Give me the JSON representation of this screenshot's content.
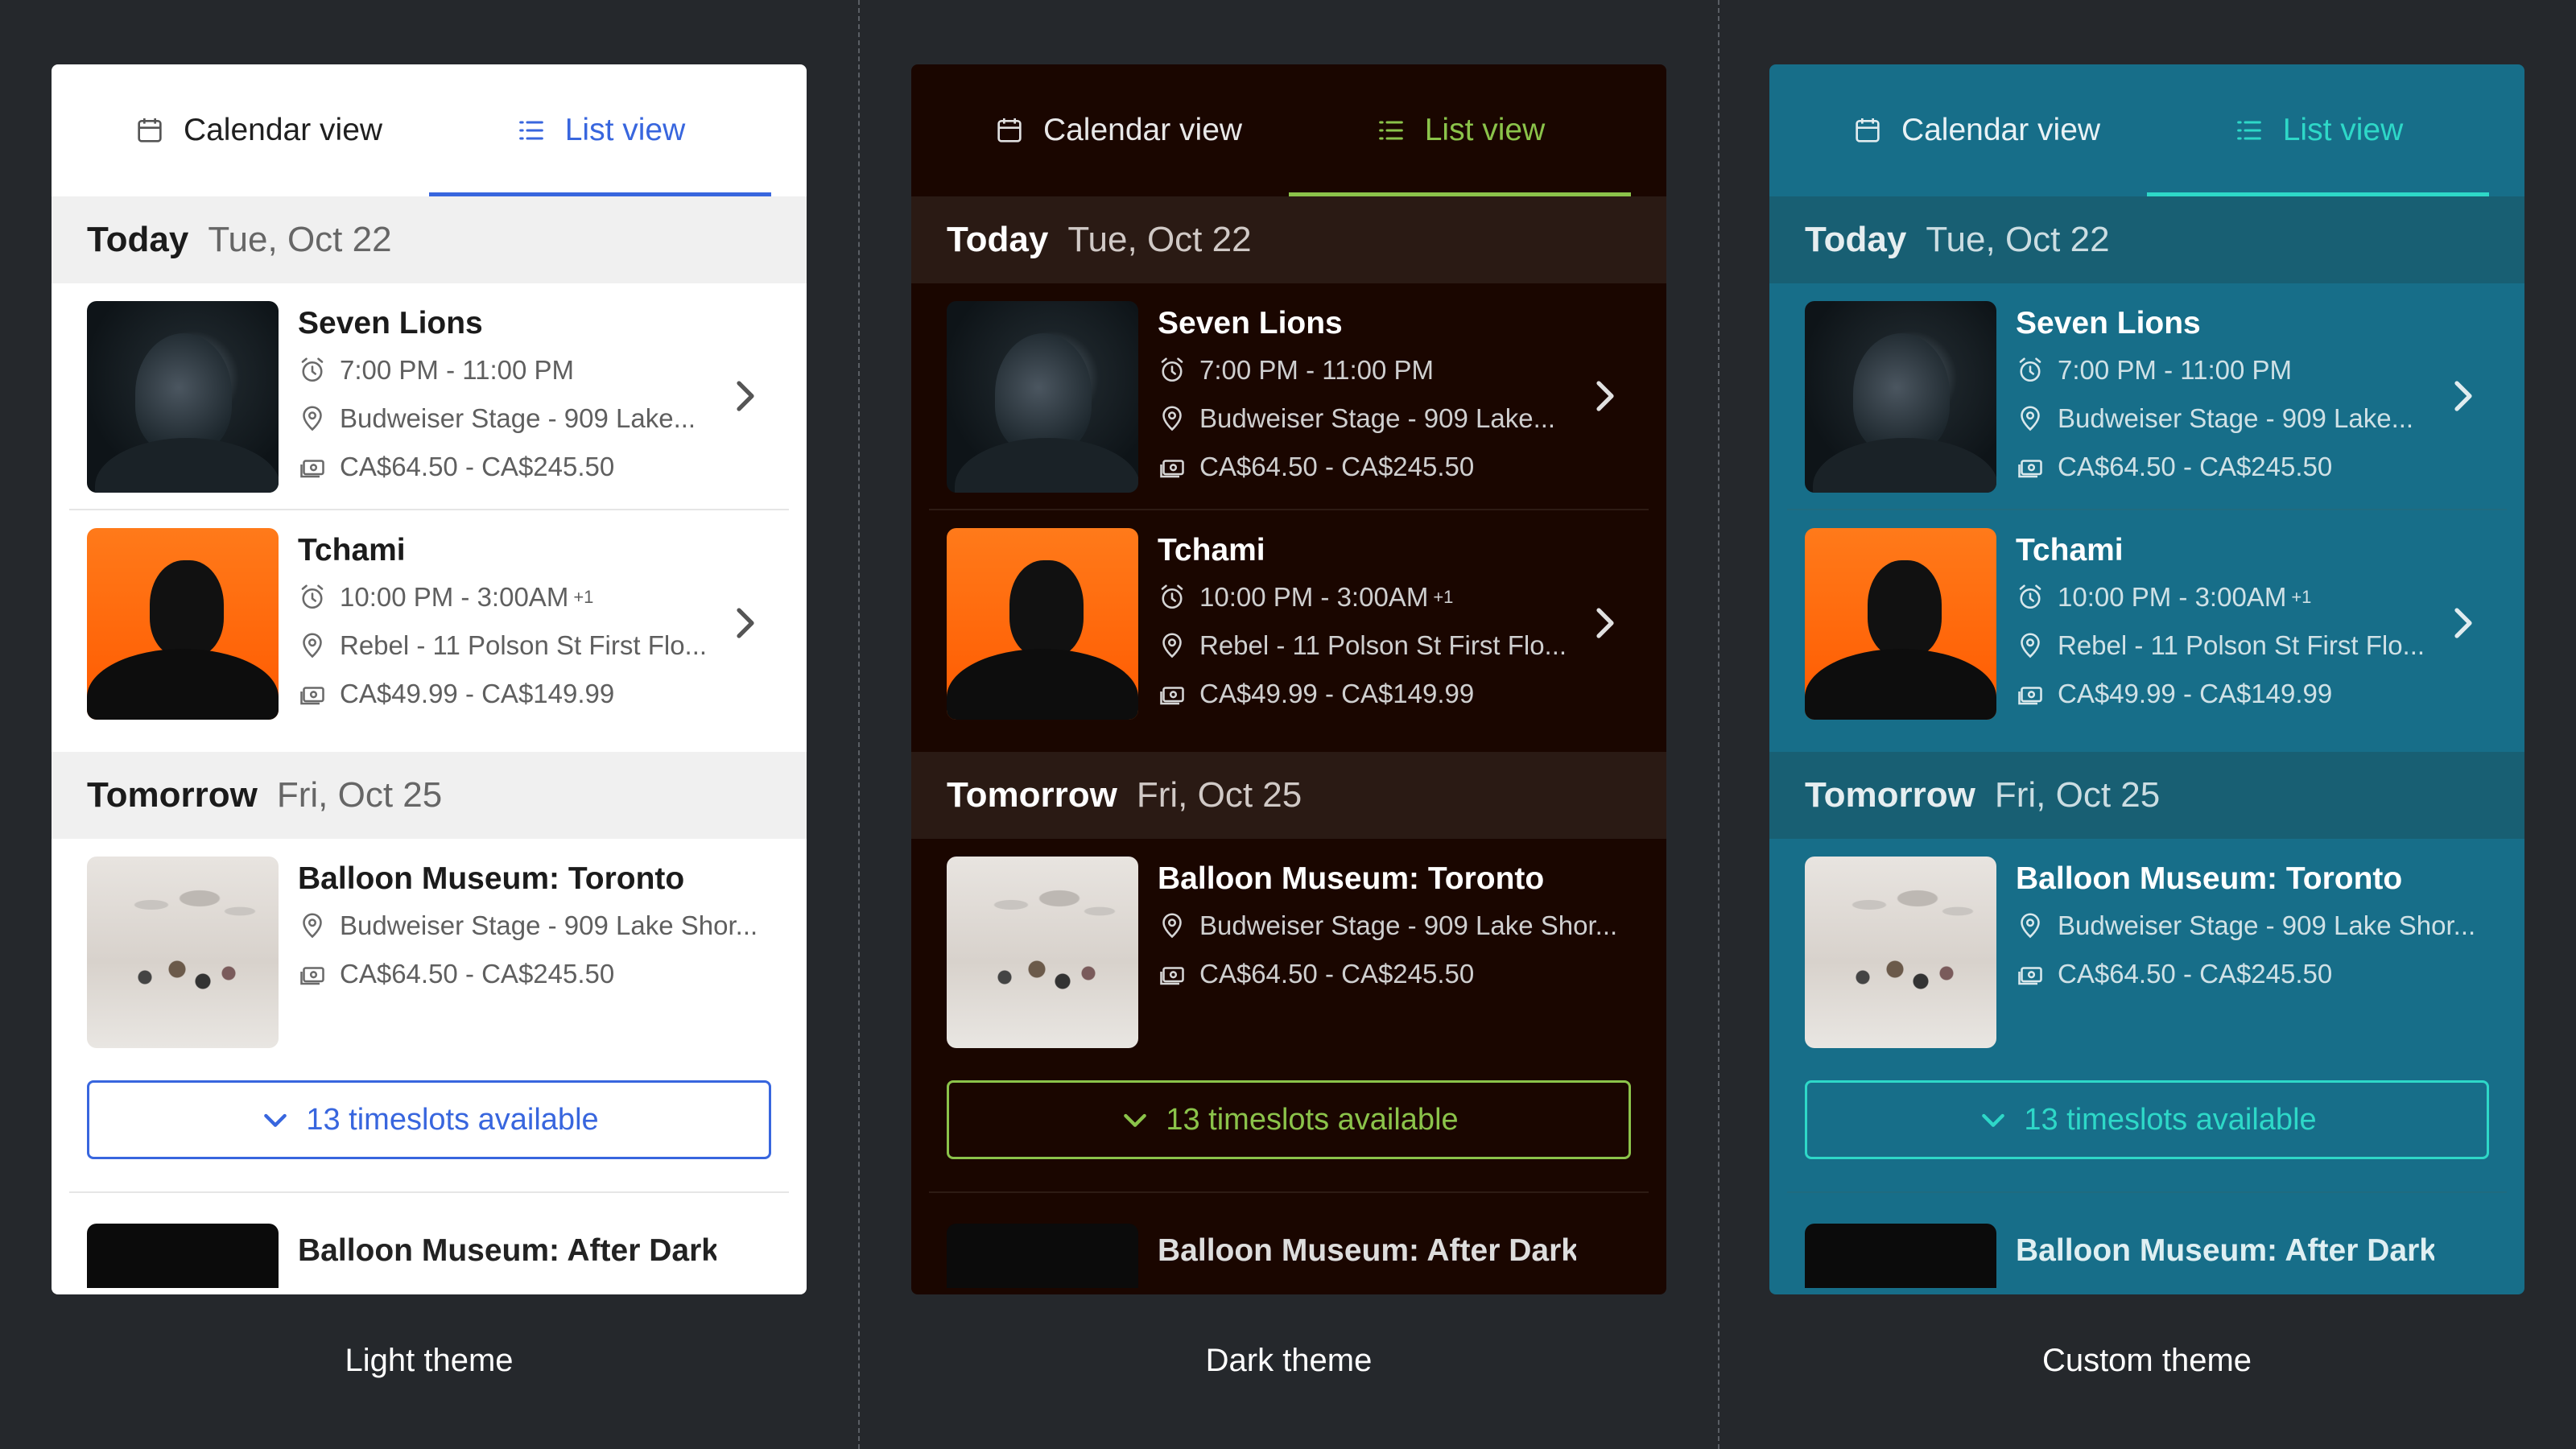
{
  "tabs": {
    "calendar_label": "Calendar view",
    "list_label": "List view",
    "active": "list"
  },
  "sections": [
    {
      "day": "Today",
      "date": "Tue, Oct 22"
    },
    {
      "day": "Tomorrow",
      "date": "Fri, Oct 25"
    }
  ],
  "events": [
    {
      "title": "Seven Lions",
      "time": "7:00 PM - 11:00 PM",
      "time_sup": "",
      "venue": "Budweiser Stage - 909 Lake...",
      "price": "CA$64.50 - CA$245.50"
    },
    {
      "title": "Tchami",
      "time": "10:00 PM - 3:00AM",
      "time_sup": "+1",
      "venue": "Rebel - 11 Polson St First Flo...",
      "price": "CA$49.99 - CA$149.99"
    },
    {
      "title": "Balloon Museum: Toronto",
      "venue": "Budweiser Stage - 909 Lake Shor...",
      "price": "CA$64.50 - CA$245.50"
    }
  ],
  "timeslots_label": "13 timeslots available",
  "peek_title": "Balloon Museum: After Dark",
  "themes": [
    {
      "caption": "Light theme",
      "accent": "#3866de",
      "background": "#ffffff"
    },
    {
      "caption": "Dark theme",
      "accent": "#8bc34a",
      "background": "#1a0600"
    },
    {
      "caption": "Custom theme",
      "accent": "#2ed8c8",
      "background": "#176e89"
    }
  ],
  "icons": {
    "calendar": "calendar-icon",
    "list": "list-icon",
    "time": "alarm-clock-icon",
    "venue": "location-pin-icon",
    "price": "ticket-money-icon",
    "chevron_right": "chevron-right-icon",
    "chevron_down": "chevron-down-icon"
  }
}
